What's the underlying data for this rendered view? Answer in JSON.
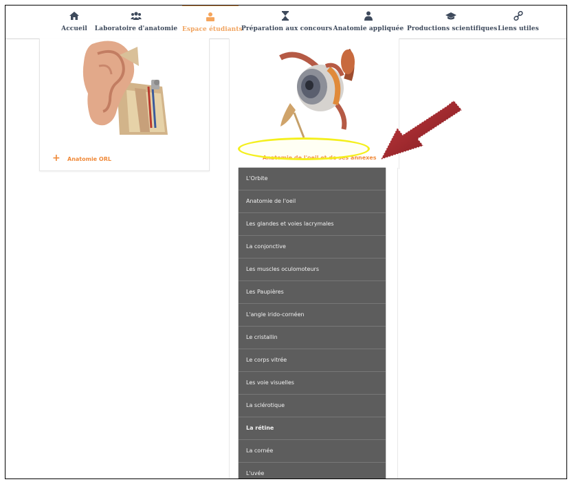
{
  "nav": {
    "items": [
      {
        "label": "Accueil",
        "icon": "home-icon"
      },
      {
        "label": "Laboratoire d'anatomie",
        "icon": "users-icon"
      },
      {
        "label": "Espace étudiants",
        "icon": "student-icon",
        "active": true
      },
      {
        "label": "Préparation aux concours",
        "icon": "hourglass-icon"
      },
      {
        "label": "Anatomie appliquée",
        "icon": "doctor-icon"
      },
      {
        "label": "Productions scientifiques",
        "icon": "graduation-cap-icon"
      },
      {
        "label": "Liens utiles",
        "icon": "link-icon"
      }
    ]
  },
  "cards": {
    "left_link": "Anatomie ORL",
    "mid_link": "Anatomie de l'oeil et de ses annexes"
  },
  "menu": {
    "items": [
      "L'Orbite",
      "Anatomie de l'oeil",
      "Les glandes et voies lacrymales",
      "La conjonctive",
      "Les muscles oculomoteurs",
      "Les Paupières",
      "L'angle irido-cornéen",
      "Le cristallin",
      "Le corps vitrée",
      "Les voie visuelles",
      "La sclérotique",
      "La rétine",
      "La cornée",
      "L'uvée"
    ]
  },
  "colors": {
    "accent": "#f08a3a",
    "nav_text": "#3e4a5c",
    "menu_bg": "#5d5d5d",
    "highlight_oval": "#f4ef1c",
    "arrow": "#a8252b"
  }
}
